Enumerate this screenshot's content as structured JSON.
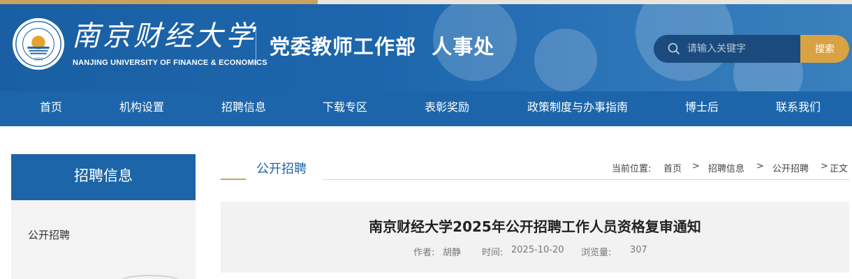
{
  "header": {
    "logo_cn": "南京财经大学",
    "logo_en": "NANJING UNIVERSITY OF FINANCE & ECONOMICS",
    "department": "党委教师工作部  人事处",
    "search_placeholder": "请输入关键字",
    "search_button": "搜索",
    "icons": [
      "university-seal",
      "search-icon"
    ]
  },
  "nav": {
    "items": [
      {
        "label": "首页"
      },
      {
        "label": "机构设置"
      },
      {
        "label": "招聘信息"
      },
      {
        "label": "下载专区"
      },
      {
        "label": "表彰奖励"
      },
      {
        "label": "政策制度与办事指南"
      },
      {
        "label": "博士后"
      },
      {
        "label": "联系我们"
      }
    ]
  },
  "sidebar": {
    "title": "招聘信息",
    "items": [
      {
        "label": "公开招聘"
      }
    ]
  },
  "content": {
    "section_title": "公开招聘",
    "breadcrumb": {
      "prefix": "当前位置:",
      "items": [
        "首页",
        "招聘信息",
        "公开招聘",
        "正文"
      ],
      "separator": ">"
    },
    "article": {
      "title": "南京财经大学2025年公开招聘工作人员资格复审通知",
      "author_label": "作者:",
      "author": "胡静",
      "time_label": "时间:",
      "time": "2025-10-20",
      "views_label": "浏览量:",
      "views": "307"
    }
  },
  "colors": {
    "primary_blue": "#1d65aa",
    "gold": "#d9a243",
    "panel_gray": "#f2f2f2"
  }
}
